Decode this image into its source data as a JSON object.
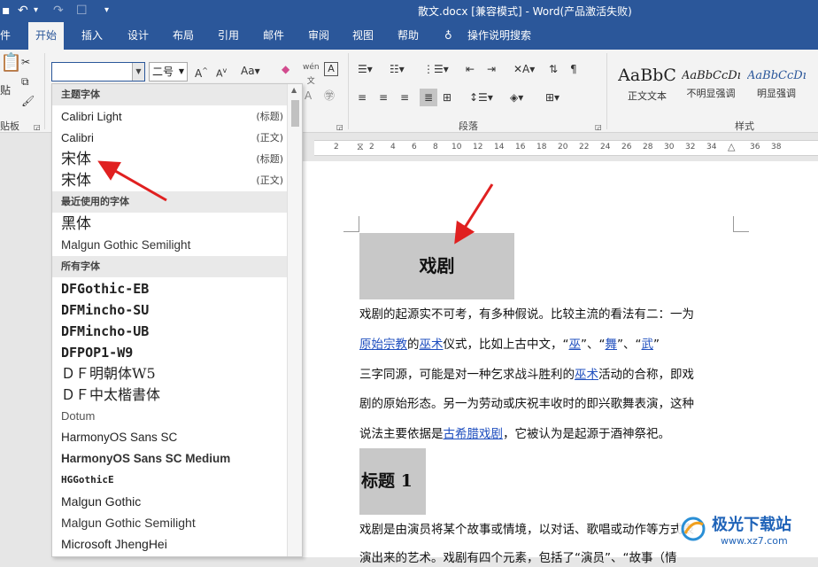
{
  "titlebar": {
    "doc_title": "散文.docx [兼容模式] - Word(产品激活失败)"
  },
  "tabs": {
    "file": "件",
    "home": "开始",
    "insert": "插入",
    "design": "设计",
    "layout": "布局",
    "references": "引用",
    "mailings": "邮件",
    "review": "审阅",
    "view": "视图",
    "help": "帮助",
    "tellme": "操作说明搜索"
  },
  "ribbon": {
    "font_value": "",
    "size_value": "二号",
    "paste_label": "贴",
    "clipboard_label": "贴板",
    "paragraph_label": "段落",
    "styles_label": "样式",
    "styles": [
      {
        "preview": "AaBbC",
        "label": "正文文本"
      },
      {
        "preview": "AaBbCcDı",
        "label": "不明显强调"
      },
      {
        "preview": "AaBbCcDı",
        "label": "明显强调"
      }
    ]
  },
  "font_dropdown": {
    "section_theme": "主题字体",
    "theme_fonts": [
      {
        "name": "Calibri Light",
        "tag": "(标题)"
      },
      {
        "name": "Calibri",
        "tag": "(正文)"
      },
      {
        "name": "宋体",
        "tag": "(标题)"
      },
      {
        "name": "宋体",
        "tag": "(正文)"
      }
    ],
    "section_recent": "最近使用的字体",
    "recent_fonts": [
      "黑体",
      "Malgun Gothic Semilight"
    ],
    "section_all": "所有字体",
    "all_fonts": [
      "DFGothic-EB",
      "DFMincho-SU",
      "DFMincho-UB",
      "DFPOP1-W9",
      "ＤＦ明朝体W5",
      "ＤＦ中太楷書体",
      "Dotum",
      "HarmonyOS Sans SC",
      "HarmonyOS Sans SC Medium",
      "HGGothicE",
      "Malgun Gothic",
      "Malgun Gothic Semilight",
      "Microsoft JhengHei"
    ]
  },
  "ruler": {
    "numbers": [
      "2",
      "2",
      "4",
      "6",
      "8",
      "10",
      "12",
      "14",
      "16",
      "18",
      "20",
      "22",
      "24",
      "26",
      "28",
      "30",
      "32",
      "34",
      "36",
      "38"
    ]
  },
  "document": {
    "title": "戏剧",
    "p1_line1": "戏剧的起源实不可考，有多种假说。比较主流的看法有二：一为",
    "p1_line2_link1": "原始宗教",
    "p1_line2_mid1": "的",
    "p1_line2_link2": "巫术",
    "p1_line2_mid2": "仪式，比如上古中文，“",
    "p1_line2_link3": "巫",
    "p1_line2_mid3": "”、“",
    "p1_line2_link4": "舞",
    "p1_line2_mid4": "”、“",
    "p1_line2_link5": "武",
    "p1_line2_end": "”",
    "p1_line3_a": "三字同源，可能是对一种乞求战斗胜利的",
    "p1_line3_link": "巫术",
    "p1_line3_b": "活动的合称，即戏",
    "p1_line4": "剧的原始形态。另一为劳动或庆祝丰收时的即兴歌舞表演，这种",
    "p1_line5_a": "说法主要依据是",
    "p1_line5_link": "古希腊戏剧",
    "p1_line5_b": "，它被认为是起源于酒神祭祀。",
    "heading1": "标题 1",
    "p2_line1": "戏剧是由演员将某个故事或情境，以对话、歌唱或动作等方式表",
    "p2_line2": "演出来的艺术。戏剧有四个元素，包括了“演员”、“故事（情"
  },
  "watermark": {
    "name": "极光下载站",
    "url": "www.xz7.com"
  },
  "colors": {
    "brand": "#2b579a",
    "arrow": "#e02020",
    "link": "#1f4fbf"
  }
}
